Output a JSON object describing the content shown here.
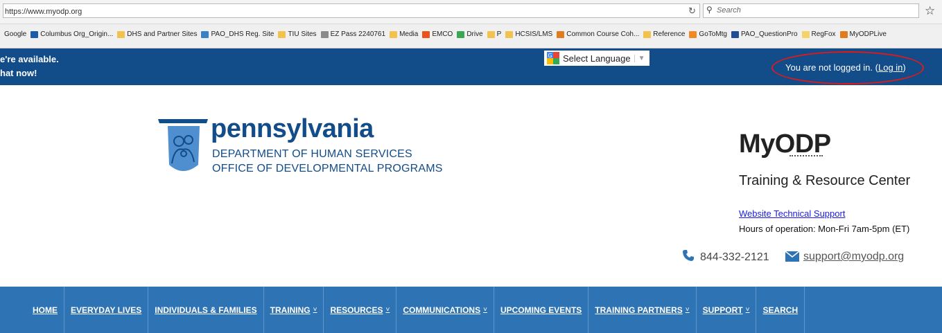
{
  "browser": {
    "url": "https://www.myodp.org",
    "search_placeholder": "Search",
    "bookmarks": [
      {
        "label": "Google",
        "icon": "google-icon",
        "color": "#ffffff"
      },
      {
        "label": "Columbus Org_Origin...",
        "icon": "page-icon",
        "color": "#1a5aa8"
      },
      {
        "label": "DHS and Partner Sites",
        "icon": "folder-icon",
        "color": "#f2c14e"
      },
      {
        "label": "PAO_DHS Reg. Site",
        "icon": "people-icon",
        "color": "#3b7fc4"
      },
      {
        "label": "TIU Sites",
        "icon": "folder-icon",
        "color": "#f2c14e"
      },
      {
        "label": "EZ Pass 2240761",
        "icon": "globe-icon",
        "color": "#8a8a8a"
      },
      {
        "label": "Media",
        "icon": "folder-icon",
        "color": "#f2c14e"
      },
      {
        "label": "EMCO",
        "icon": "blogger-icon",
        "color": "#e8531e"
      },
      {
        "label": "Drive",
        "icon": "drive-icon",
        "color": "#3aa757"
      },
      {
        "label": "P",
        "icon": "folder-icon",
        "color": "#f2c14e"
      },
      {
        "label": "HCSIS/LMS",
        "icon": "folder-icon",
        "color": "#f2c14e"
      },
      {
        "label": "Common Course Coh...",
        "icon": "moodle-icon",
        "color": "#e07b1f"
      },
      {
        "label": "Reference",
        "icon": "folder-icon",
        "color": "#f2c14e"
      },
      {
        "label": "GoToMtg",
        "icon": "gotomeeting-icon",
        "color": "#f08a24"
      },
      {
        "label": "PAO_QuestionPro",
        "icon": "questionpro-icon",
        "color": "#1f4e96"
      },
      {
        "label": "RegFox",
        "icon": "regfox-icon",
        "color": "#f5d36b"
      },
      {
        "label": "MyODPLive",
        "icon": "moodle-icon",
        "color": "#e07b1f"
      }
    ]
  },
  "topbar": {
    "chat_line1": "e're available.",
    "chat_line2": "hat now!",
    "language_label": "Select Language",
    "login_status": "You are not logged in.",
    "login_paren_open": "(",
    "login_link": "Log in",
    "login_paren_close": ")"
  },
  "header": {
    "state_name": "pennsylvania",
    "department": "DEPARTMENT OF HUMAN SERVICES",
    "office": "OFFICE OF DEVELOPMENTAL PROGRAMS",
    "site_title": "MyODP",
    "site_subtitle": "Training & Resource Center",
    "support_link": "Website Technical Support",
    "hours": "Hours of operation: Mon-Fri 7am-5pm (ET)",
    "phone": "844-332-2121",
    "email": "support@myodp.org"
  },
  "nav": [
    {
      "label": "HOME",
      "dropdown": false
    },
    {
      "label": "EVERYDAY LIVES",
      "dropdown": false
    },
    {
      "label": "INDIVIDUALS & FAMILIES",
      "dropdown": false
    },
    {
      "label": "TRAINING",
      "dropdown": true
    },
    {
      "label": "RESOURCES",
      "dropdown": true
    },
    {
      "label": "COMMUNICATIONS",
      "dropdown": true
    },
    {
      "label": "UPCOMING EVENTS",
      "dropdown": false
    },
    {
      "label": "TRAINING PARTNERS",
      "dropdown": true
    },
    {
      "label": "SUPPORT",
      "dropdown": true
    },
    {
      "label": "SEARCH",
      "dropdown": false
    }
  ],
  "colors": {
    "brand_blue": "#124c89",
    "nav_blue": "#2e74b5",
    "highlight_red": "#e01a1a",
    "link_blue": "#1a1ae6"
  }
}
